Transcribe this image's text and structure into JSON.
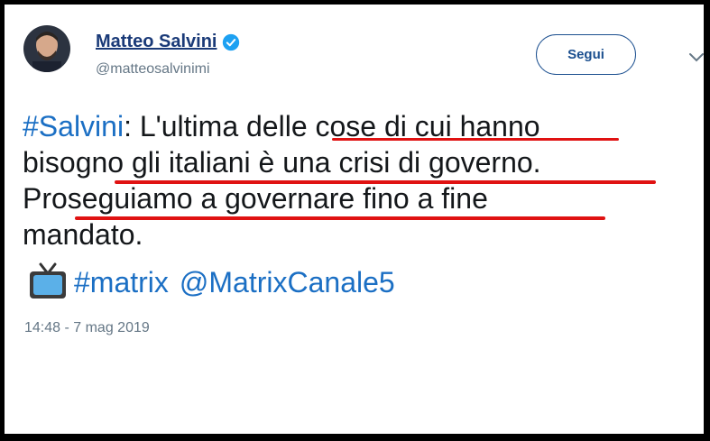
{
  "user": {
    "name": "Matteo Salvini",
    "handle": "@matteosalvinimi"
  },
  "follow_button_label": "Segui",
  "tweet": {
    "hashtag_prefix": "#Salvini",
    "lines": [
      ": L'ultima delle cose di cui hanno",
      "bisogno gli italiani è una crisi di governo.",
      "Proseguiamo a governare fino a fine",
      "mandato."
    ],
    "hashtag": "#matrix",
    "mention": "@MatrixCanale5"
  },
  "timestamp": "14:48 - 7 mag 2019",
  "colors": {
    "link": "#1b6fc4",
    "underline_annotation": "#e01212",
    "verified": "#1da1f2"
  },
  "icons": [
    "verified-badge-icon",
    "chevron-down-icon",
    "tv-emoji-icon"
  ]
}
